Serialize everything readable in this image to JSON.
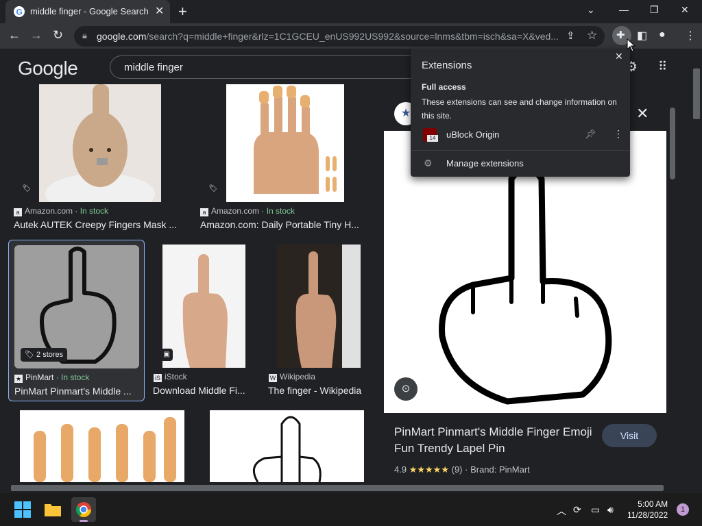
{
  "browser": {
    "tab_title": "middle finger - Google Search",
    "url_host": "google.com",
    "url_rest": "/search?q=middle+finger&rlz=1C1GCEU_enUS992US992&source=lnms&tbm=isch&sa=X&ved..."
  },
  "google": {
    "logo": "Google",
    "query": "middle finger"
  },
  "results": [
    {
      "source": "Amazon.com",
      "stock": "In stock",
      "caption": "Autek AUTEK Creepy Fingers Mask ..."
    },
    {
      "source": "Amazon.com",
      "stock": "In stock",
      "caption": "Amazon.com: Daily Portable Tiny H..."
    },
    {
      "source": "PinMart",
      "stock": "In stock",
      "caption": "PinMart Pinmart's Middle ...",
      "badge": "2 stores"
    },
    {
      "source": "iStock",
      "stock": "",
      "caption": "Download Middle Fi..."
    },
    {
      "source": "Wikipedia",
      "stock": "",
      "caption": "The finger - Wikipedia"
    }
  ],
  "preview": {
    "title": "PinMart Pinmart's Middle Finger Emoji Fun Trendy Lapel Pin",
    "visit_label": "Visit",
    "rating": "4.9",
    "stars": "★★★★★",
    "reviews": "(9)",
    "brand": "Brand: PinMart"
  },
  "extensions_popup": {
    "heading": "Extensions",
    "subheading": "Full access",
    "description": "These extensions can see and change information on this site.",
    "extension_name": "uBlock Origin",
    "extension_badge": "14",
    "manage_label": "Manage extensions"
  },
  "taskbar": {
    "time": "5:00 AM",
    "date": "11/28/2022",
    "notification_count": "1"
  },
  "colors": {
    "background": "#202124",
    "accent": "#8ab4f8",
    "in_stock": "#81c995"
  }
}
